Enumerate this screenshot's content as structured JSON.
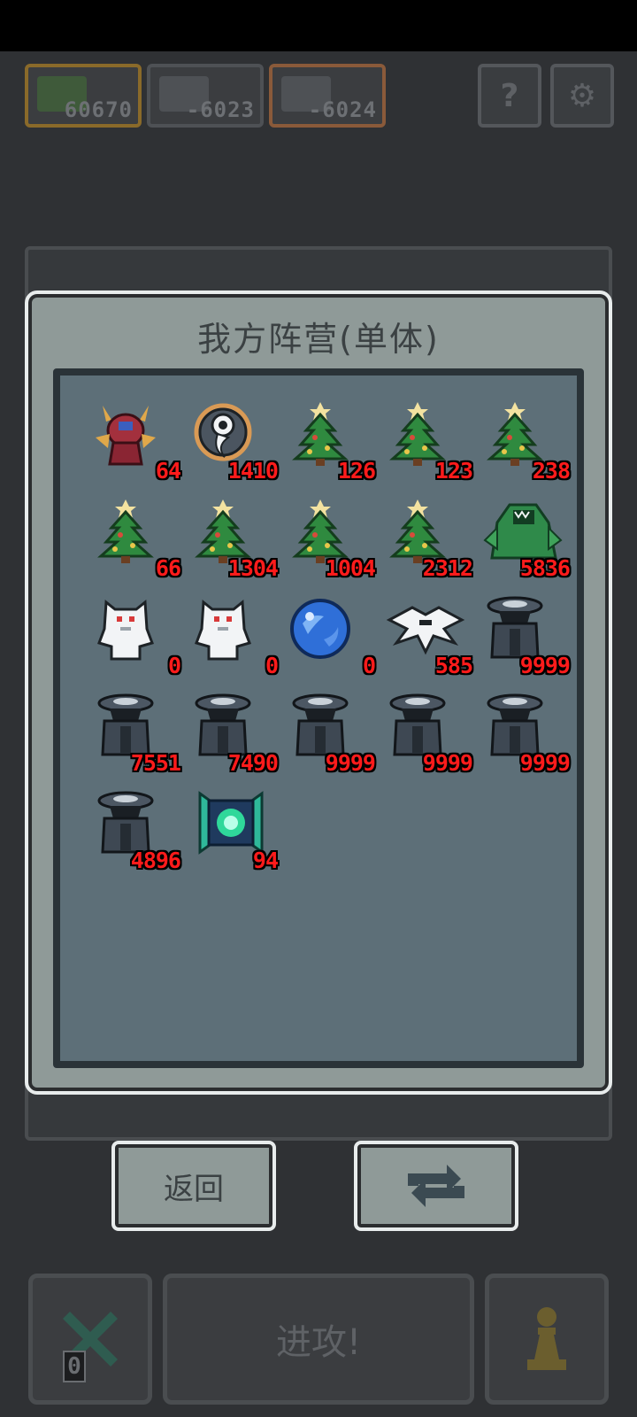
{
  "header": {
    "slots": [
      {
        "name": "player",
        "score": "60670",
        "border": "#b88a2a"
      },
      {
        "name": "enemy-1",
        "score": "-6023",
        "border": "#4e5155"
      },
      {
        "name": "enemy-2",
        "score": "-6024",
        "border": "#b86a3a"
      }
    ],
    "help_icon": "question-icon",
    "settings_icon": "gear-icon",
    "help_label": "?",
    "settings_label": "⚙"
  },
  "modal": {
    "title": "我方阵营(单体)",
    "units": [
      {
        "sprite": "red-demon",
        "count": "64"
      },
      {
        "sprite": "ring-spirit",
        "count": "1410"
      },
      {
        "sprite": "christmas-tree",
        "count": "126"
      },
      {
        "sprite": "christmas-tree",
        "count": "123"
      },
      {
        "sprite": "christmas-tree",
        "count": "238"
      },
      {
        "sprite": "christmas-tree",
        "count": "66"
      },
      {
        "sprite": "christmas-tree",
        "count": "1304"
      },
      {
        "sprite": "christmas-tree",
        "count": "1004"
      },
      {
        "sprite": "christmas-tree",
        "count": "2312"
      },
      {
        "sprite": "green-beast",
        "count": "5836"
      },
      {
        "sprite": "white-golem",
        "count": "0"
      },
      {
        "sprite": "white-golem",
        "count": "0"
      },
      {
        "sprite": "blue-orb",
        "count": "0"
      },
      {
        "sprite": "white-wyvern",
        "count": "585"
      },
      {
        "sprite": "dark-sentinel",
        "count": "9999"
      },
      {
        "sprite": "dark-sentinel",
        "count": "7551"
      },
      {
        "sprite": "dark-sentinel",
        "count": "7490"
      },
      {
        "sprite": "dark-sentinel",
        "count": "9999"
      },
      {
        "sprite": "dark-sentinel",
        "count": "9999"
      },
      {
        "sprite": "dark-sentinel",
        "count": "9999"
      },
      {
        "sprite": "dark-sentinel",
        "count": "4896"
      },
      {
        "sprite": "cyan-machine",
        "count": "94"
      }
    ]
  },
  "buttons": {
    "back_label": "返回",
    "swap_icon": "swap-arrows-icon"
  },
  "bottom": {
    "cancel_icon": "x-icon",
    "attack_label": "进攻!",
    "pawn_icon": "pawn-icon",
    "zero_badge": "0"
  }
}
